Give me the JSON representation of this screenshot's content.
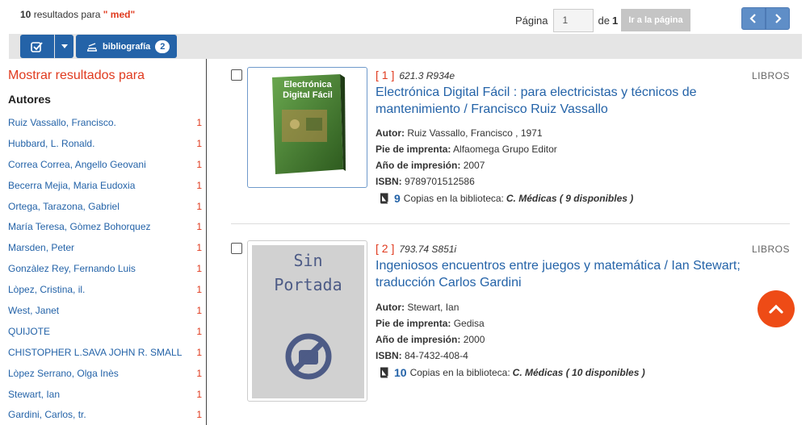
{
  "summary": {
    "count": "10",
    "text": "resultados para",
    "term": "\" med\""
  },
  "pagination": {
    "page_label": "Página",
    "page_value": "1",
    "of_label": "de",
    "total": "1",
    "go_label": "Ir a la página"
  },
  "toolbar": {
    "bibliography_label": "bibliografía",
    "bibliography_count": "2"
  },
  "sidebar": {
    "heading": "Mostrar resultados para",
    "group_title": "Autores",
    "items": [
      {
        "name": "Ruiz Vassallo, Francisco.",
        "count": "1"
      },
      {
        "name": "Hubbard, L. Ronald.",
        "count": "1"
      },
      {
        "name": "Correa Correa, Angello Geovani",
        "count": "1"
      },
      {
        "name": "Becerra Mejia, Maria Eudoxia",
        "count": "1"
      },
      {
        "name": "Ortega, Tarazona, Gabriel",
        "count": "1"
      },
      {
        "name": "María Teresa, Gòmez Bohorquez",
        "count": "1"
      },
      {
        "name": "Marsden, Peter",
        "count": "1"
      },
      {
        "name": "Gonzàlez Rey, Fernando Luis",
        "count": "1"
      },
      {
        "name": "Lòpez, Cristina, il.",
        "count": "1"
      },
      {
        "name": "West, Janet",
        "count": "1"
      },
      {
        "name": "QUIJOTE",
        "count": "1"
      },
      {
        "name": "CHISTOPHER L.SAVA JOHN R. SMALL",
        "count": "1"
      },
      {
        "name": "Lòpez Serrano, Olga Inès",
        "count": "1"
      },
      {
        "name": "Stewart, Ian",
        "count": "1"
      },
      {
        "name": "Gardini, Carlos, tr.",
        "count": "1"
      }
    ]
  },
  "labels": {
    "author": "Autor:",
    "imprint": "Pie de imprenta:",
    "year": "Año de impresión:",
    "isbn": "ISBN:",
    "copies_text": "Copias en la biblioteca:"
  },
  "results": [
    {
      "rank": "[ 1 ]",
      "call_number": "621.3 R934e",
      "type": "LIBROS",
      "title": "Electrónica Digital Fácil : para electricistas y técnicos de mantenimiento / Francisco Ruiz Vassallo",
      "author": "Ruiz Vassallo, Francisco , 1971",
      "imprint": "Alfaomega Grupo Editor",
      "year": "2007",
      "isbn": "9789701512586",
      "copies": "9",
      "library": "C. Médicas",
      "availability": "( 9 disponibles )",
      "cover_text": [
        "Electrónica",
        "Digital Fácil"
      ]
    },
    {
      "rank": "[ 2 ]",
      "call_number": "793.74 S851i",
      "type": "LIBROS",
      "title": "Ingeniosos encuentros entre juegos y matemática / Ian Stewart; traducción Carlos Gardini",
      "author": "Stewart, Ian",
      "imprint": "Gedisa",
      "year": "2000",
      "isbn": "84-7432-408-4",
      "copies": "10",
      "library": "C. Médicas",
      "availability": "( 10 disponibles )",
      "cover_text": [
        "Sin",
        "Portada"
      ]
    }
  ],
  "colors": {
    "accent_blue": "#2463a8",
    "accent_red": "#e03a1e",
    "scroll_button": "#ee4b16"
  },
  "icons": [
    "check-square-icon",
    "caret-down-icon",
    "stack-icon",
    "chevron-left-icon",
    "chevron-right-icon",
    "book-icon",
    "no-image-icon",
    "chevron-up-icon"
  ]
}
